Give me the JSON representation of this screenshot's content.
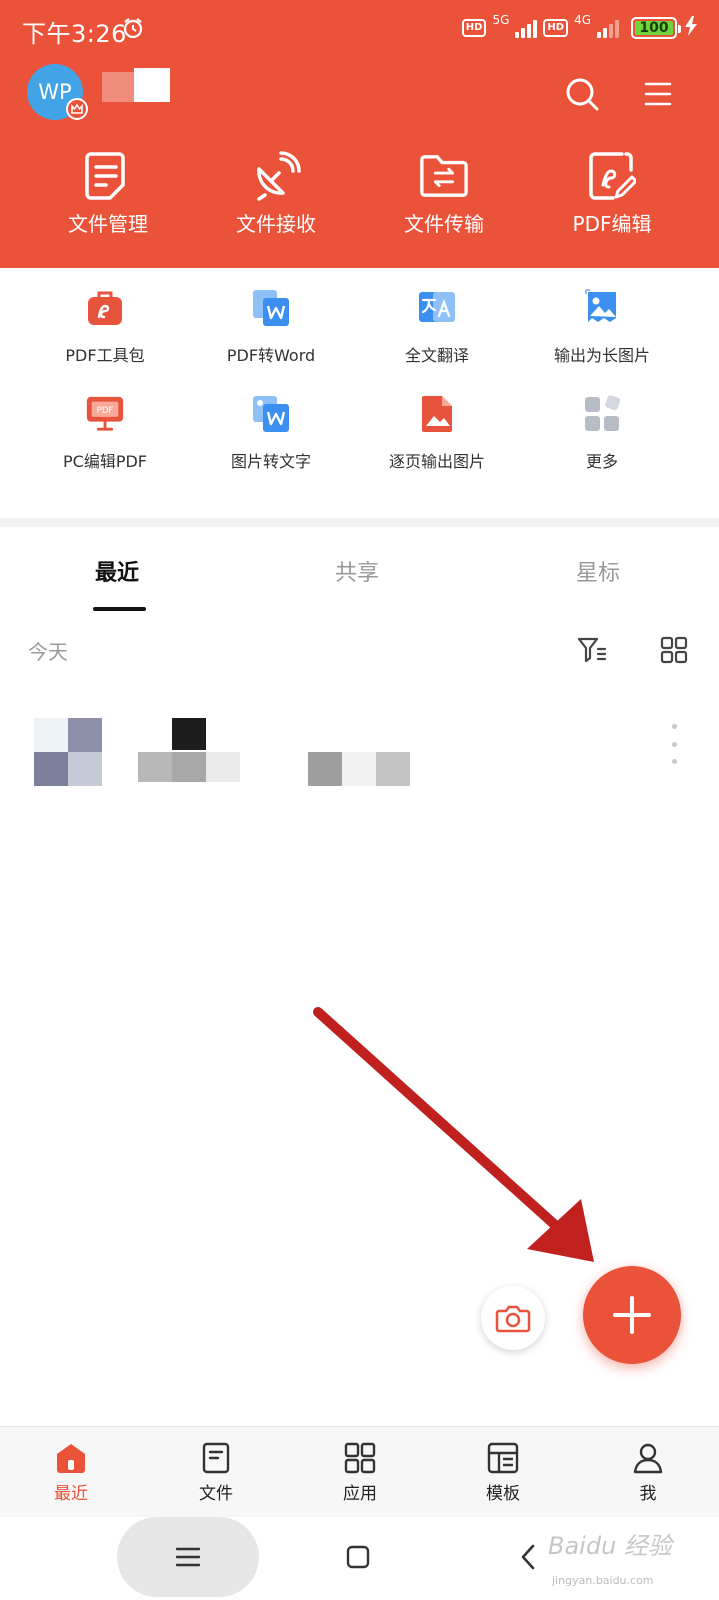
{
  "status_bar": {
    "time": "下午3:26",
    "net_5g": "5G",
    "net_4g": "4G",
    "hd": "HD",
    "battery": "100"
  },
  "header": {
    "avatar_initials": "WP",
    "actions": [
      {
        "label": "文件管理",
        "icon": "document-icon"
      },
      {
        "label": "文件接收",
        "icon": "satellite-dish-icon"
      },
      {
        "label": "文件传输",
        "icon": "folder-transfer-icon"
      },
      {
        "label": "PDF编辑",
        "icon": "pdf-edit-icon"
      }
    ]
  },
  "tools": [
    {
      "label": "PDF工具包",
      "icon": "pdf-toolkit-icon"
    },
    {
      "label": "PDF转Word",
      "icon": "pdf-to-word-icon"
    },
    {
      "label": "全文翻译",
      "icon": "translate-icon"
    },
    {
      "label": "输出为长图片",
      "icon": "long-image-icon"
    },
    {
      "label": "PC编辑PDF",
      "icon": "pc-pdf-icon"
    },
    {
      "label": "图片转文字",
      "icon": "image-to-text-icon"
    },
    {
      "label": "逐页输出图片",
      "icon": "page-image-icon"
    },
    {
      "label": "更多",
      "icon": "more-apps-icon"
    }
  ],
  "tabs": [
    {
      "label": "最近"
    },
    {
      "label": "共享"
    },
    {
      "label": "星标"
    }
  ],
  "section_today": "今天",
  "bottom_nav": [
    {
      "label": "最近",
      "icon": "home-icon"
    },
    {
      "label": "文件",
      "icon": "file-icon"
    },
    {
      "label": "应用",
      "icon": "apps-icon"
    },
    {
      "label": "模板",
      "icon": "template-icon"
    },
    {
      "label": "我",
      "icon": "user-icon"
    }
  ],
  "watermark": {
    "text": "Baidu 经验",
    "sub": "jingyan.baidu.com"
  },
  "colors": {
    "brand_red": "#ea5239",
    "avatar_blue": "#42a4e6",
    "tool_blue": "#3b8ff0",
    "annotation_arrow": "#c0201e"
  }
}
